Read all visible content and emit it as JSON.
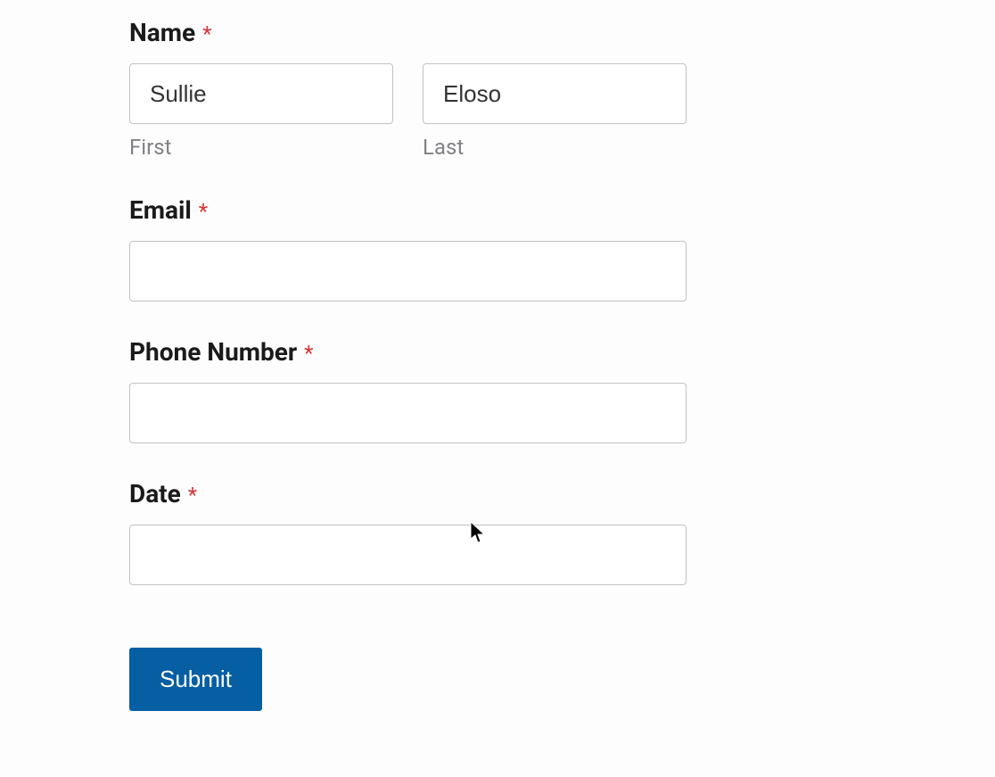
{
  "form": {
    "name": {
      "label": "Name",
      "required": "*",
      "first": {
        "value": "Sullie",
        "sublabel": "First"
      },
      "last": {
        "value": "Eloso",
        "sublabel": "Last"
      }
    },
    "email": {
      "label": "Email",
      "required": "*",
      "value": ""
    },
    "phone": {
      "label": "Phone Number",
      "required": "*",
      "value": ""
    },
    "date": {
      "label": "Date",
      "required": "*",
      "value": ""
    },
    "submit": {
      "label": "Submit"
    }
  }
}
